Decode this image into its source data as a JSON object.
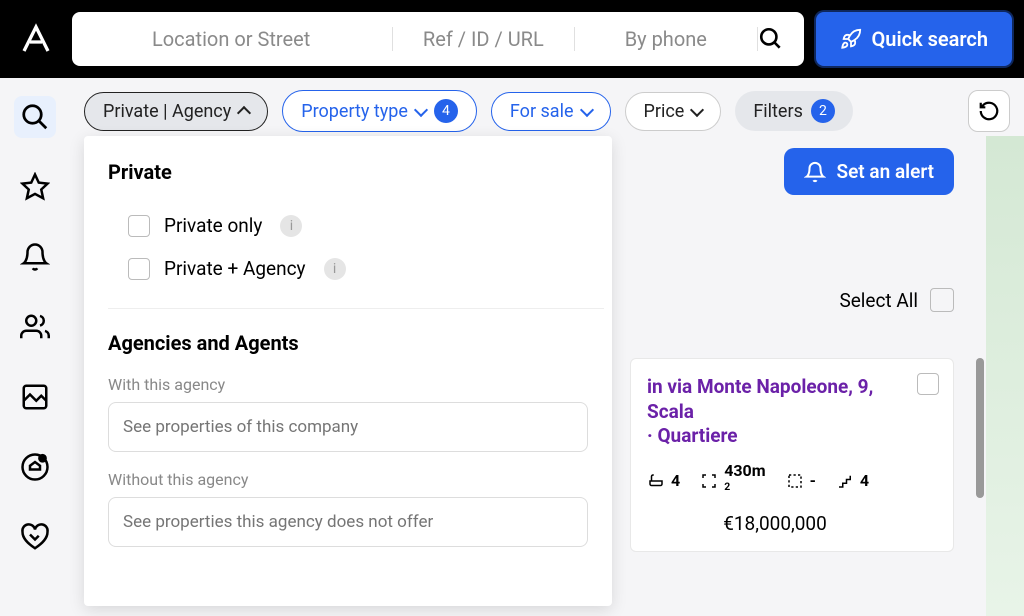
{
  "header": {
    "search_location_placeholder": "Location or Street",
    "search_ref_placeholder": "Ref / ID / URL",
    "search_phone_placeholder": "By phone",
    "quick_search": "Quick search"
  },
  "chips": {
    "private_agency": "Private | Agency",
    "property_type": "Property type",
    "property_type_count": "4",
    "for_sale": "For sale",
    "price": "Price",
    "filters": "Filters",
    "filters_count": "2"
  },
  "dropdown": {
    "section_private": "Private",
    "option_private_only": "Private only",
    "option_private_agency": "Private + Agency",
    "section_agencies": "Agencies and Agents",
    "with_agency_label": "With this agency",
    "with_agency_placeholder": "See properties of this company",
    "without_agency_label": "Without this agency",
    "without_agency_placeholder": "See properties this agency does not offer"
  },
  "right": {
    "set_alert": "Set an alert",
    "select_all": "Select All"
  },
  "listing": {
    "title_line1": "in via Monte Napoleone, 9, Scala",
    "title_line2": "· Quartiere",
    "bath": "4",
    "area": "430m",
    "area_unit": "2",
    "other": "-",
    "floors": "4",
    "price": "€18,000,000"
  }
}
